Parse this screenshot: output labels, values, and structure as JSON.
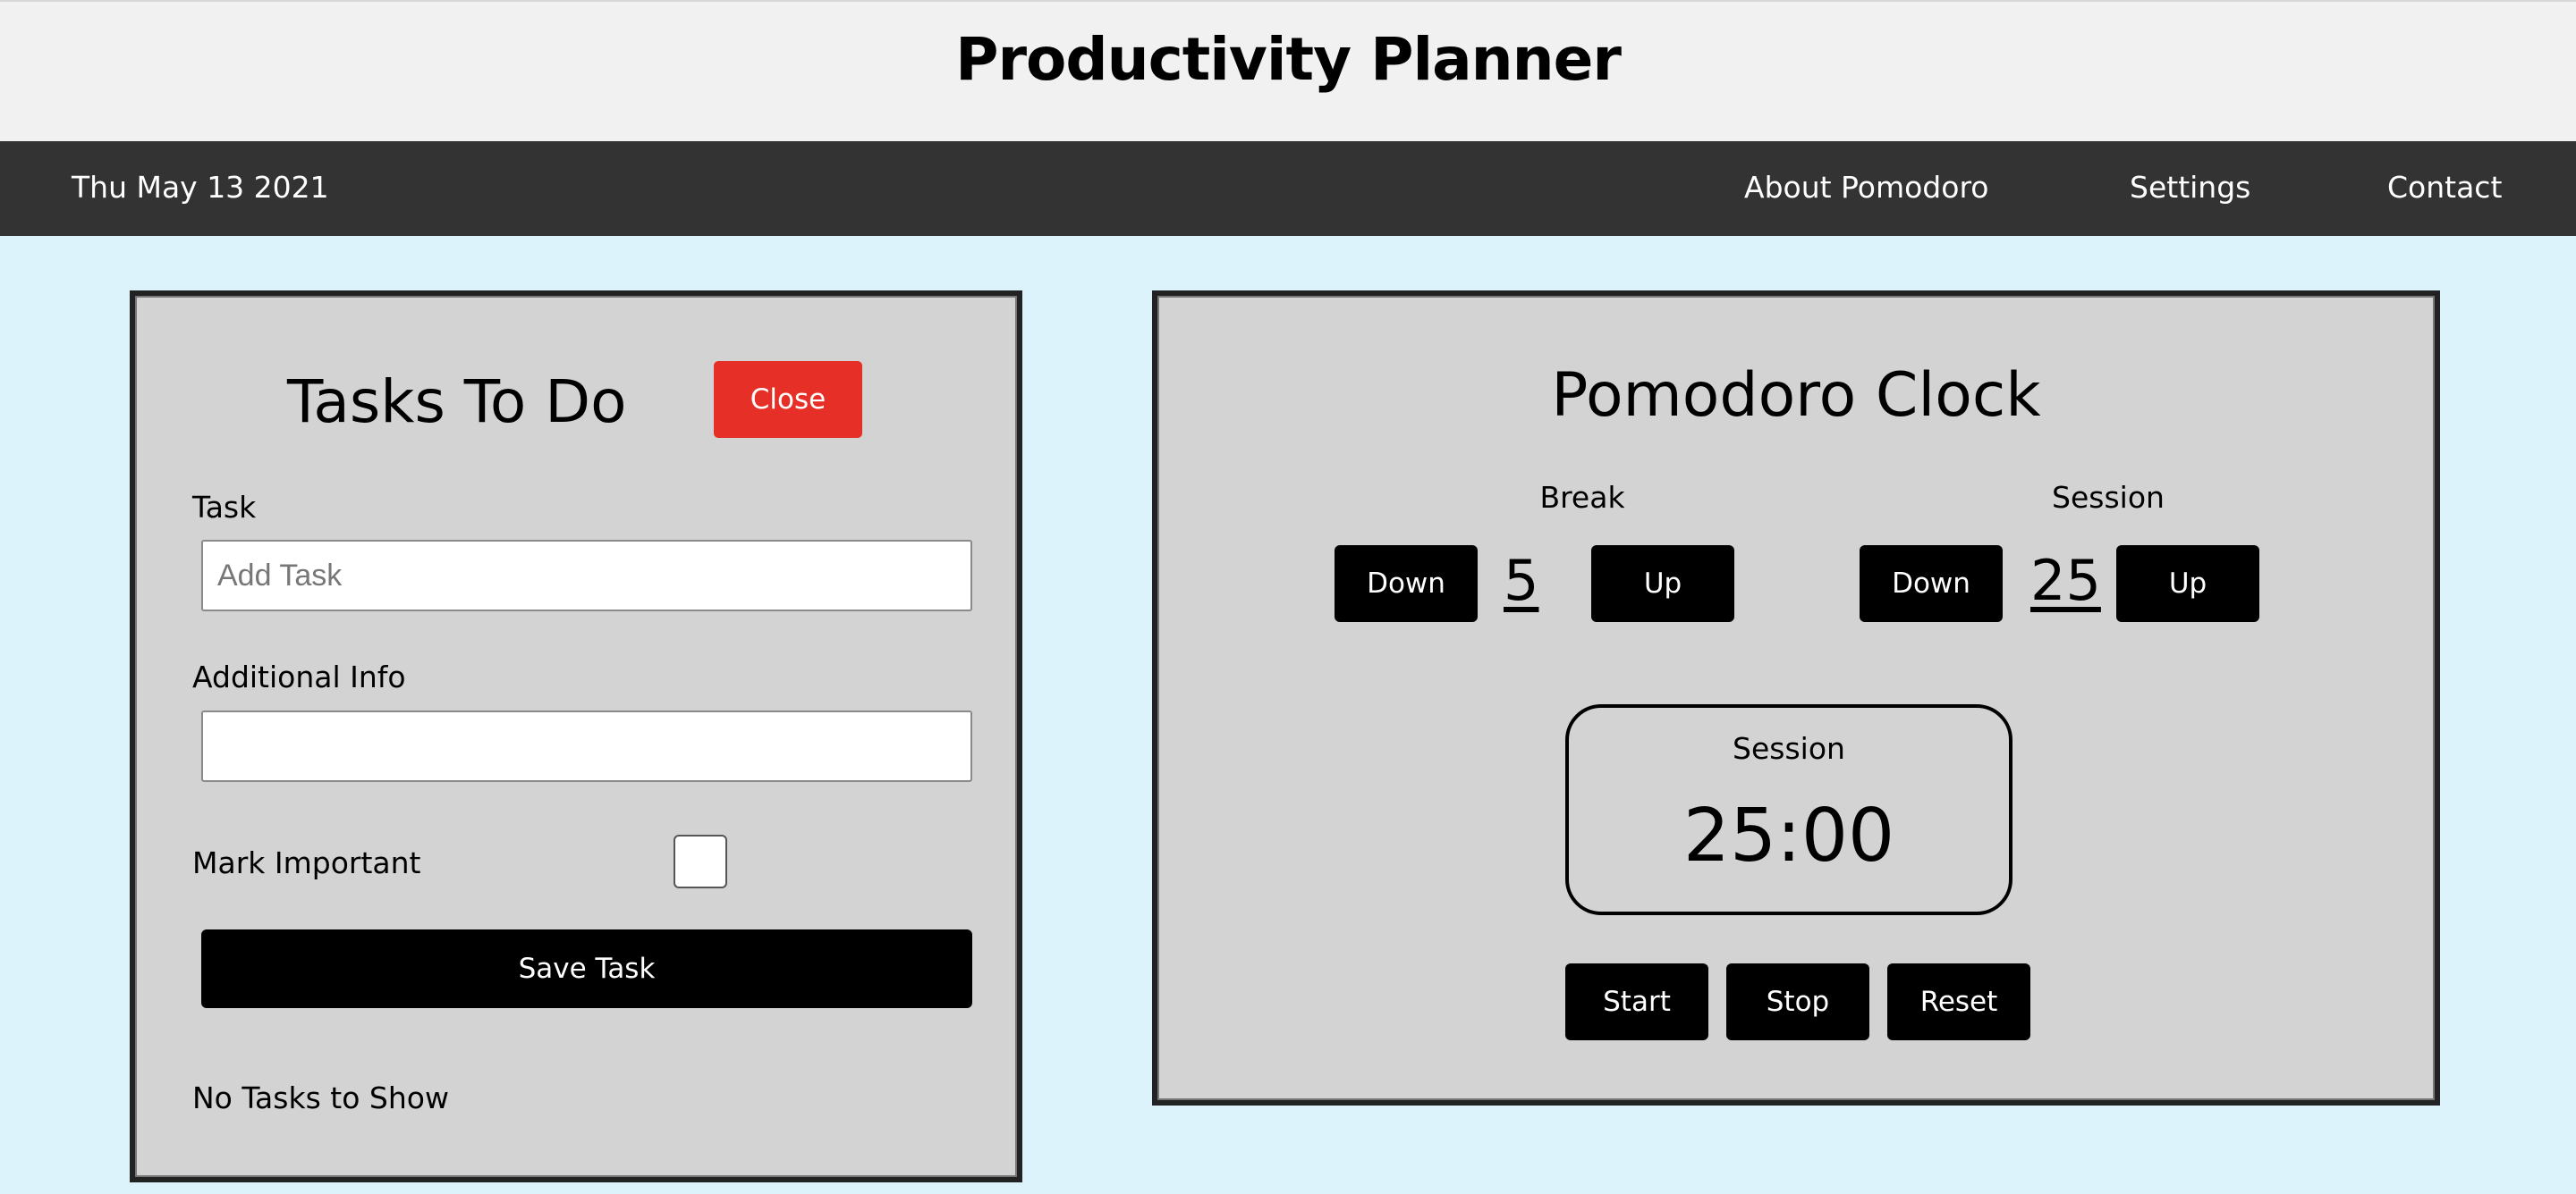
{
  "header": {
    "title": "Productivity Planner"
  },
  "nav": {
    "date": "Thu May 13 2021",
    "links": [
      "About Pomodoro",
      "Settings",
      "Contact"
    ]
  },
  "tasks": {
    "title": "Tasks To Do",
    "close_label": "Close",
    "task_label": "Task",
    "task_placeholder": "Add Task",
    "task_value": "",
    "info_label": "Additional Info",
    "info_value": "",
    "important_label": "Mark Important",
    "important_checked": false,
    "save_label": "Save Task",
    "empty_message": "No Tasks to Show"
  },
  "clock": {
    "title": "Pomodoro Clock",
    "break_label": "Break",
    "session_label": "Session",
    "down_label": "Down",
    "up_label": "Up",
    "break_value": "5",
    "session_value": "25",
    "timer_label": "Session",
    "timer_value": "25:00",
    "start_label": "Start",
    "stop_label": "Stop",
    "reset_label": "Reset"
  },
  "colors": {
    "page_bg": "#dcf3fb",
    "header_bg": "#f1f1f1",
    "nav_bg": "#333333",
    "panel_bg": "#d3d3d3",
    "close_button": "#e63027",
    "button": "#000000"
  }
}
